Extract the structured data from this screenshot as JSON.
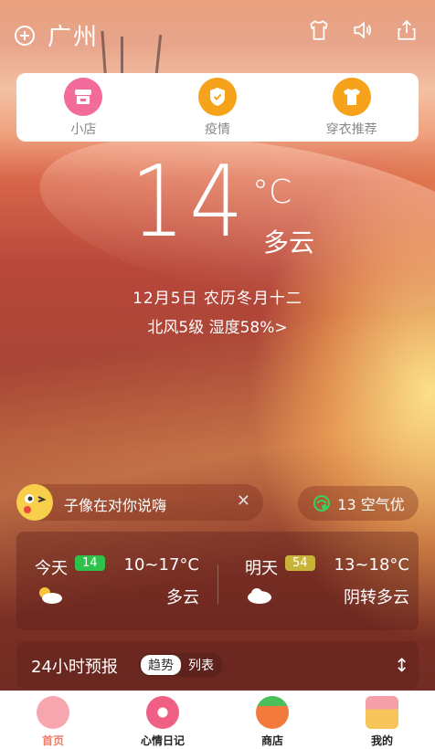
{
  "status_bar": {
    "city": "广州"
  },
  "quick_actions": [
    {
      "label": "小店",
      "icon": "shop-icon"
    },
    {
      "label": "疫情",
      "icon": "shield-icon"
    },
    {
      "label": "穿衣推荐",
      "icon": "shirt-icon"
    }
  ],
  "weather": {
    "temperature": "14",
    "unit": "°C",
    "condition": "多云",
    "date_line": "12月5日  农历冬月十二",
    "wind_humidity": "北风5级  湿度58%>"
  },
  "greeting": {
    "text": "子像在对你说嗨",
    "close": "✕"
  },
  "air_quality": {
    "text": "13 空气优"
  },
  "forecast": {
    "today": {
      "day": "今天",
      "aqi": "14",
      "range": "10~17°C",
      "condition": "多云",
      "aqi_color": "#2ec24a"
    },
    "tomorrow": {
      "day": "明天",
      "aqi": "54",
      "range": "13~18°C",
      "condition": "阴转多云",
      "aqi_color": "#c9b43a"
    }
  },
  "hourly": {
    "title": "24小时预报",
    "tab_active": "趋势",
    "tab_other": "列表"
  },
  "nav": [
    {
      "label": "首页",
      "icon": "pig-icon",
      "active": true
    },
    {
      "label": "心情日记",
      "icon": "donut-icon",
      "active": false
    },
    {
      "label": "商店",
      "icon": "carrot-icon",
      "active": false
    },
    {
      "label": "我的",
      "icon": "drink-icon",
      "active": false
    }
  ]
}
